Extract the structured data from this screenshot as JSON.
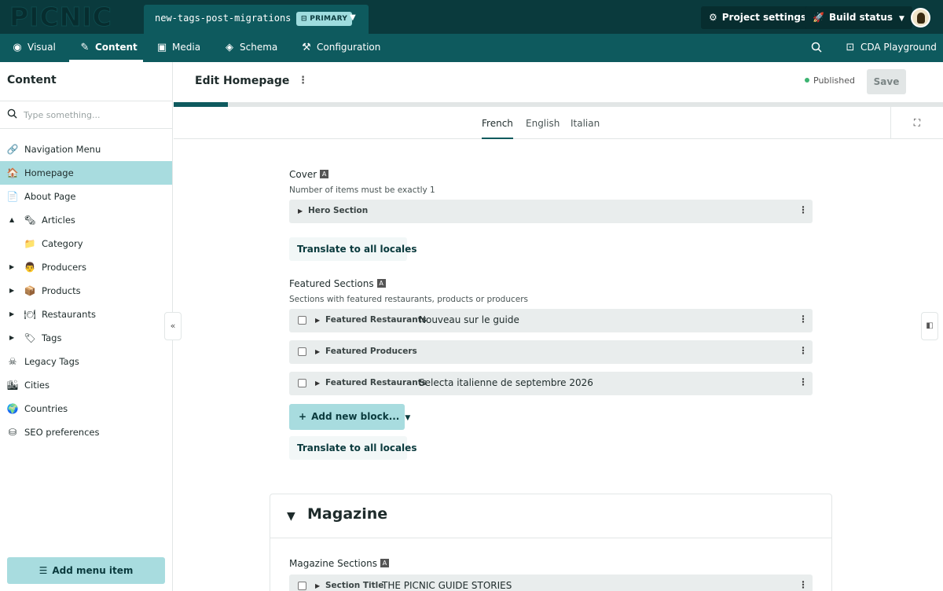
{
  "app": {
    "logo": "PICNIC"
  },
  "branch": {
    "name": "new-tags-post-migrations",
    "badge": "PRIMARY"
  },
  "topbar": {
    "project_settings": "Project settings",
    "build_status": "Build status"
  },
  "nav": {
    "visual": "Visual",
    "content": "Content",
    "media": "Media",
    "schema": "Schema",
    "configuration": "Configuration",
    "cda_playground": "CDA Playground"
  },
  "sidebar": {
    "title": "Content",
    "search_placeholder": "Type something...",
    "items": [
      {
        "label": "Navigation Menu",
        "icon": "link-icon"
      },
      {
        "label": "Homepage",
        "icon": "house-icon"
      },
      {
        "label": "About Page",
        "icon": "page-icon"
      },
      {
        "label": "Articles",
        "icon": "newspaper-icon"
      },
      {
        "label": "Category",
        "icon": "folder-icon"
      },
      {
        "label": "Producers",
        "icon": "farmer-icon"
      },
      {
        "label": "Products",
        "icon": "package-icon"
      },
      {
        "label": "Restaurants",
        "icon": "plate-icon"
      },
      {
        "label": "Tags",
        "icon": "tag-icon"
      },
      {
        "label": "Legacy Tags",
        "icon": "skull-icon"
      },
      {
        "label": "Cities",
        "icon": "city-icon"
      },
      {
        "label": "Countries",
        "icon": "globe-icon"
      },
      {
        "label": "SEO preferences",
        "icon": "settings-icon"
      }
    ],
    "add_menu_item": "Add menu item"
  },
  "editor": {
    "title": "Edit Homepage",
    "status": "Published",
    "save": "Save",
    "progress": 0.07,
    "locales": [
      "French",
      "English",
      "Italian"
    ],
    "active_locale": "French"
  },
  "fields": {
    "cover": {
      "label": "Cover",
      "hint": "Number of items must be exactly 1",
      "blocks": [
        {
          "name": "Hero Section",
          "value": ""
        }
      ],
      "translate": "Translate to all locales"
    },
    "featured": {
      "label": "Featured Sections",
      "hint": "Sections with featured restaurants, products or producers",
      "blocks": [
        {
          "name": "Featured Restaurants",
          "value": "Nouveau sur le guide"
        },
        {
          "name": "Featured Producers",
          "value": ""
        },
        {
          "name": "Featured Restaurants",
          "value": "Selecta italienne de septembre 2026"
        }
      ],
      "add_block": "Add new block...",
      "translate": "Translate to all locales"
    }
  },
  "magazine": {
    "title": "Magazine",
    "field_label": "Magazine Sections",
    "blocks": [
      {
        "name": "Section Title",
        "value": "THE PICNIC GUIDE STORIES"
      }
    ]
  }
}
